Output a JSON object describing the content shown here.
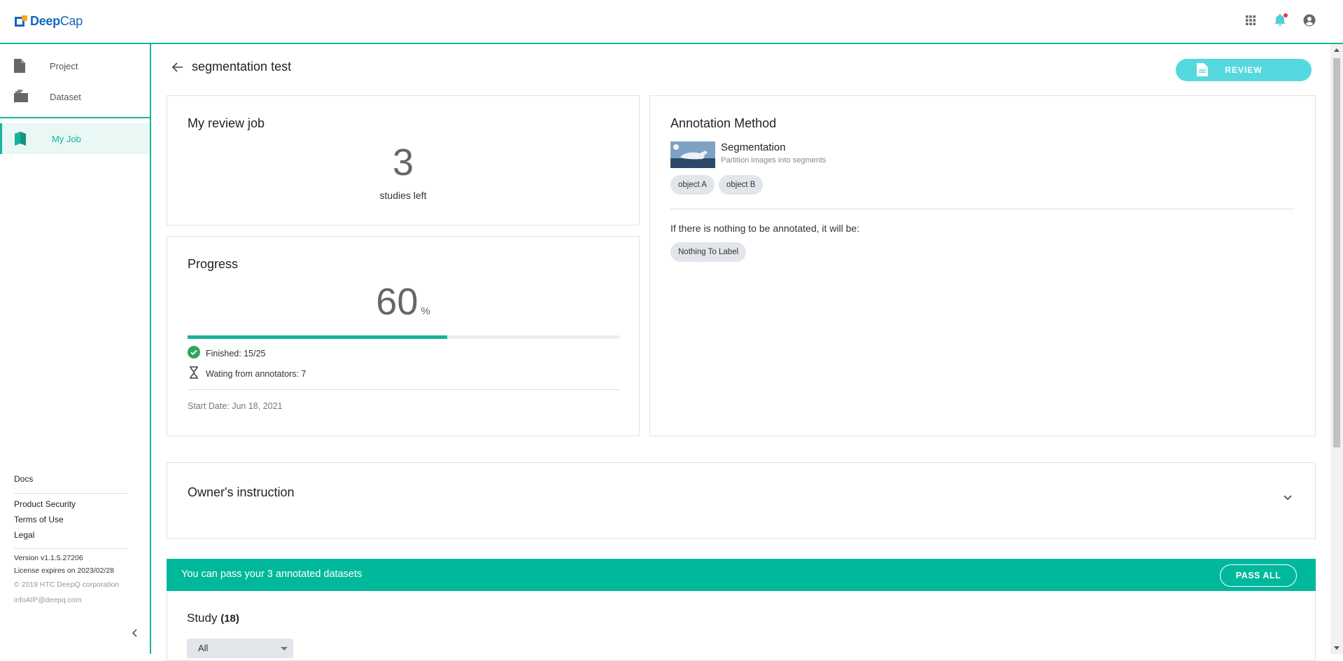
{
  "app": {
    "brand_bold": "Deep",
    "brand_rest": "Cap"
  },
  "topbar": {
    "icons": [
      "apps-grid-icon",
      "bell-icon",
      "account-icon"
    ],
    "accent": "#18b39b"
  },
  "sidebar": {
    "items": [
      {
        "label": "Project",
        "icon": "file-icon"
      },
      {
        "label": "Dataset",
        "icon": "folder-icon"
      },
      {
        "label": "My Job",
        "icon": "book-icon",
        "active": true
      }
    ],
    "footer": {
      "docs": "Docs",
      "product_security": "Product Security",
      "terms": "Terms of Use",
      "legal": "Legal",
      "version": "Version v1.1.5.27206",
      "license": "License expires on 2023/02/28",
      "copyright": "© 2019 HTC DeepQ corporation",
      "email": "infoAIP@deepq.com"
    }
  },
  "page": {
    "title": "segmentation test",
    "review_button": "REVIEW"
  },
  "review_job": {
    "title": "My review job",
    "count": "3",
    "count_label": "studies left"
  },
  "progress": {
    "title": "Progress",
    "value": "60",
    "unit": "%",
    "fraction": 0.6,
    "finished": "Finished: 15/25",
    "waiting": "Wating from annotators: 7",
    "start_date": "Start Date: Jun 18, 2021"
  },
  "annotation": {
    "title": "Annotation Method",
    "method_name": "Segmentation",
    "method_desc": "Partition images into segments",
    "labels": [
      "object A",
      "object B"
    ],
    "empty_text": "If there is nothing to be annotated, it will be:",
    "empty_label": "Nothing To Label"
  },
  "instruction": {
    "title": "Owner's instruction"
  },
  "pass_bar": {
    "text": "You can pass your 3 annotated datasets",
    "button": "PASS ALL"
  },
  "study": {
    "title": "Study",
    "count": "(18)",
    "filter_value": "All"
  }
}
